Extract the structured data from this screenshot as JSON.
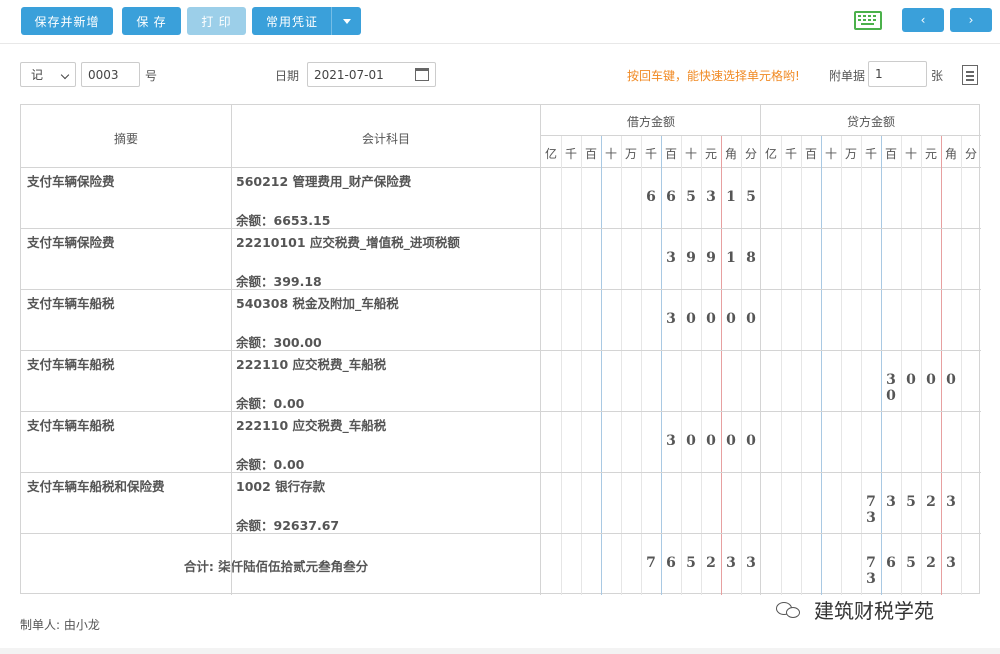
{
  "toolbar": {
    "save_new_label": "保存并新增",
    "save_label": "保 存",
    "print_label": "打 印",
    "common_voucher_label": "常用凭证",
    "prev_label": "‹",
    "next_label": "›"
  },
  "header": {
    "voucher_word": "记",
    "voucher_number": "0003",
    "number_suffix": "号",
    "date_label": "日期",
    "date_value": "2021-07-01",
    "hint": "按回车键，能快速选择单元格哟!",
    "attachments_label": "附单据",
    "attachments_value": "1",
    "attachments_unit": "张"
  },
  "table": {
    "col_summary": "摘要",
    "col_account": "会计科目",
    "col_debit": "借方金额",
    "col_credit": "贷方金额",
    "digit_units": [
      "亿",
      "千",
      "百",
      "十",
      "万",
      "千",
      "百",
      "十",
      "元",
      "角",
      "分"
    ],
    "rows": [
      {
        "summary": "支付车辆保险费",
        "account": "560212 管理费用_财产保险费",
        "balance": "余额：6653.15",
        "debit": "665315",
        "credit": ""
      },
      {
        "summary": "支付车辆保险费",
        "account": "22210101 应交税费_增值税_进项税额",
        "balance": "余额：399.18",
        "debit": "39918",
        "credit": ""
      },
      {
        "summary": "支付车辆车船税",
        "account": "540308 税金及附加_车船税",
        "balance": "余额：300.00",
        "debit": "30000",
        "credit": ""
      },
      {
        "summary": "支付车辆车船税",
        "account": "222110 应交税费_车船税",
        "balance": "余额：0.00",
        "debit": "",
        "credit": "30000"
      },
      {
        "summary": "支付车辆车船税",
        "account": "222110 应交税费_车船税",
        "balance": "余额：0.00",
        "debit": "30000",
        "credit": ""
      },
      {
        "summary": "支付车辆车船税和保险费",
        "account": "1002 银行存款",
        "balance": "余额：92637.67",
        "debit": "",
        "credit": "735233"
      }
    ],
    "total_label": "合计: 柒仟陆佰伍拾贰元叁角叁分",
    "total_debit": "765233",
    "total_credit": "765233"
  },
  "footer": {
    "maker": "制单人:   由小龙",
    "watermark": "建筑财税学苑"
  },
  "colors": {
    "primary": "#3aa0da",
    "disabled": "#9ccfe9",
    "hint": "#f08a24",
    "keyboard_icon": "#4bb14b",
    "yuan_divider": "#e7a0a0",
    "thousand_divider": "#a9c9e3"
  }
}
